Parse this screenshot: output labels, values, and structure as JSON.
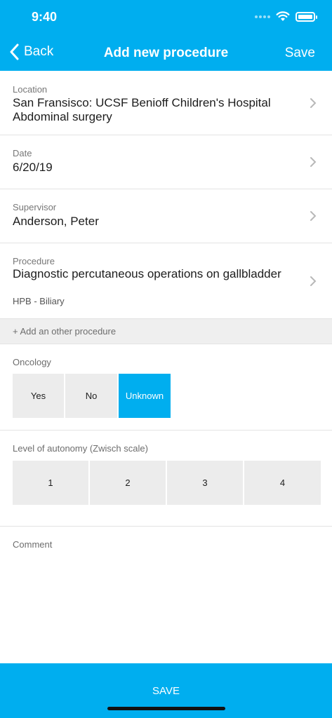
{
  "status": {
    "time": "9:40"
  },
  "nav": {
    "back_label": "Back",
    "title": "Add new procedure",
    "save_label": "Save"
  },
  "location": {
    "label": "Location",
    "value": "San Fransisco: UCSF Benioff Children's Hospital Abdominal surgery"
  },
  "date": {
    "label": "Date",
    "value": "6/20/19"
  },
  "supervisor": {
    "label": "Supervisor",
    "value": "Anderson, Peter"
  },
  "procedure": {
    "label": "Procedure",
    "value": "Diagnostic percutaneous operations on gallbladder",
    "category": "HPB - Biliary"
  },
  "add_procedure_label": "+ Add an other procedure",
  "oncology": {
    "label": "Oncology",
    "options": [
      "Yes",
      "No",
      "Unknown"
    ],
    "selected": "Unknown"
  },
  "autonomy": {
    "label": "Level of autonomy (Zwisch scale)",
    "options": [
      "1",
      "2",
      "3",
      "4"
    ],
    "selected": null
  },
  "comment": {
    "label": "Comment",
    "value": ""
  },
  "footer": {
    "save_label": "SAVE"
  },
  "colors": {
    "accent": "#00aeef",
    "segment_bg": "#ececec",
    "section_bg": "#efefef"
  },
  "icons": {
    "back": "chevron-left-icon",
    "row": "chevron-right-icon",
    "wifi": "wifi-icon",
    "battery": "battery-icon"
  }
}
